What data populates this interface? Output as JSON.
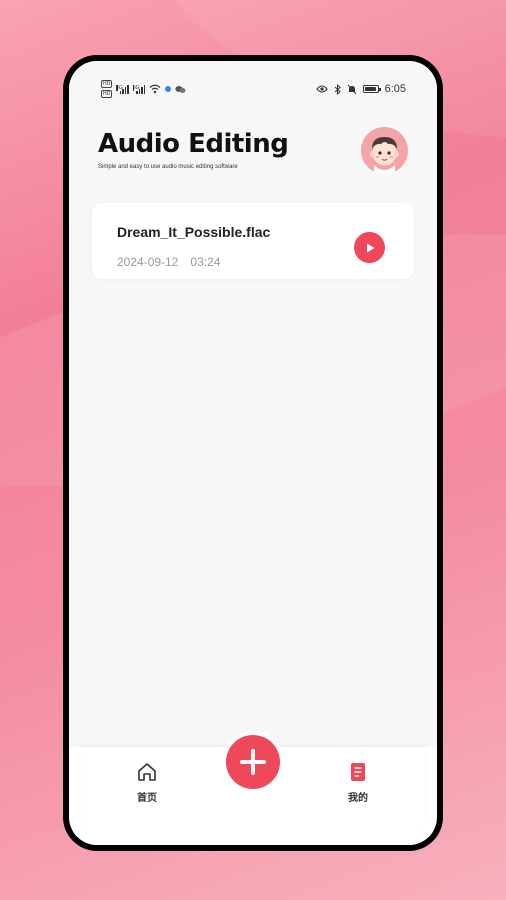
{
  "status_bar": {
    "hd_badges": [
      "HD",
      "HD"
    ],
    "sim1_label": "5G",
    "sim2_label": "5G",
    "time": "6:05",
    "icons": [
      "signal-icon",
      "wifi-icon",
      "wechat-icon",
      "eye-icon",
      "bluetooth-icon",
      "mute-icon",
      "battery-icon"
    ]
  },
  "header": {
    "title": "Audio Editing",
    "subtitle": "Simple and easy to use audio music editing software",
    "avatar_icon": "boy-avatar"
  },
  "recordings": [
    {
      "file_name": "Dream_It_Possible.flac",
      "date": "2024-09-12",
      "duration": "03:24",
      "action_icon": "play-icon"
    }
  ],
  "tab_bar": {
    "home_label": "首页",
    "add_icon": "plus-icon",
    "mine_label": "我的"
  },
  "colors": {
    "accent": "#f0485b",
    "avatar_bg": "#f3a4a8",
    "page_bg": "#f7f7f7",
    "backdrop": "#f27f98"
  }
}
